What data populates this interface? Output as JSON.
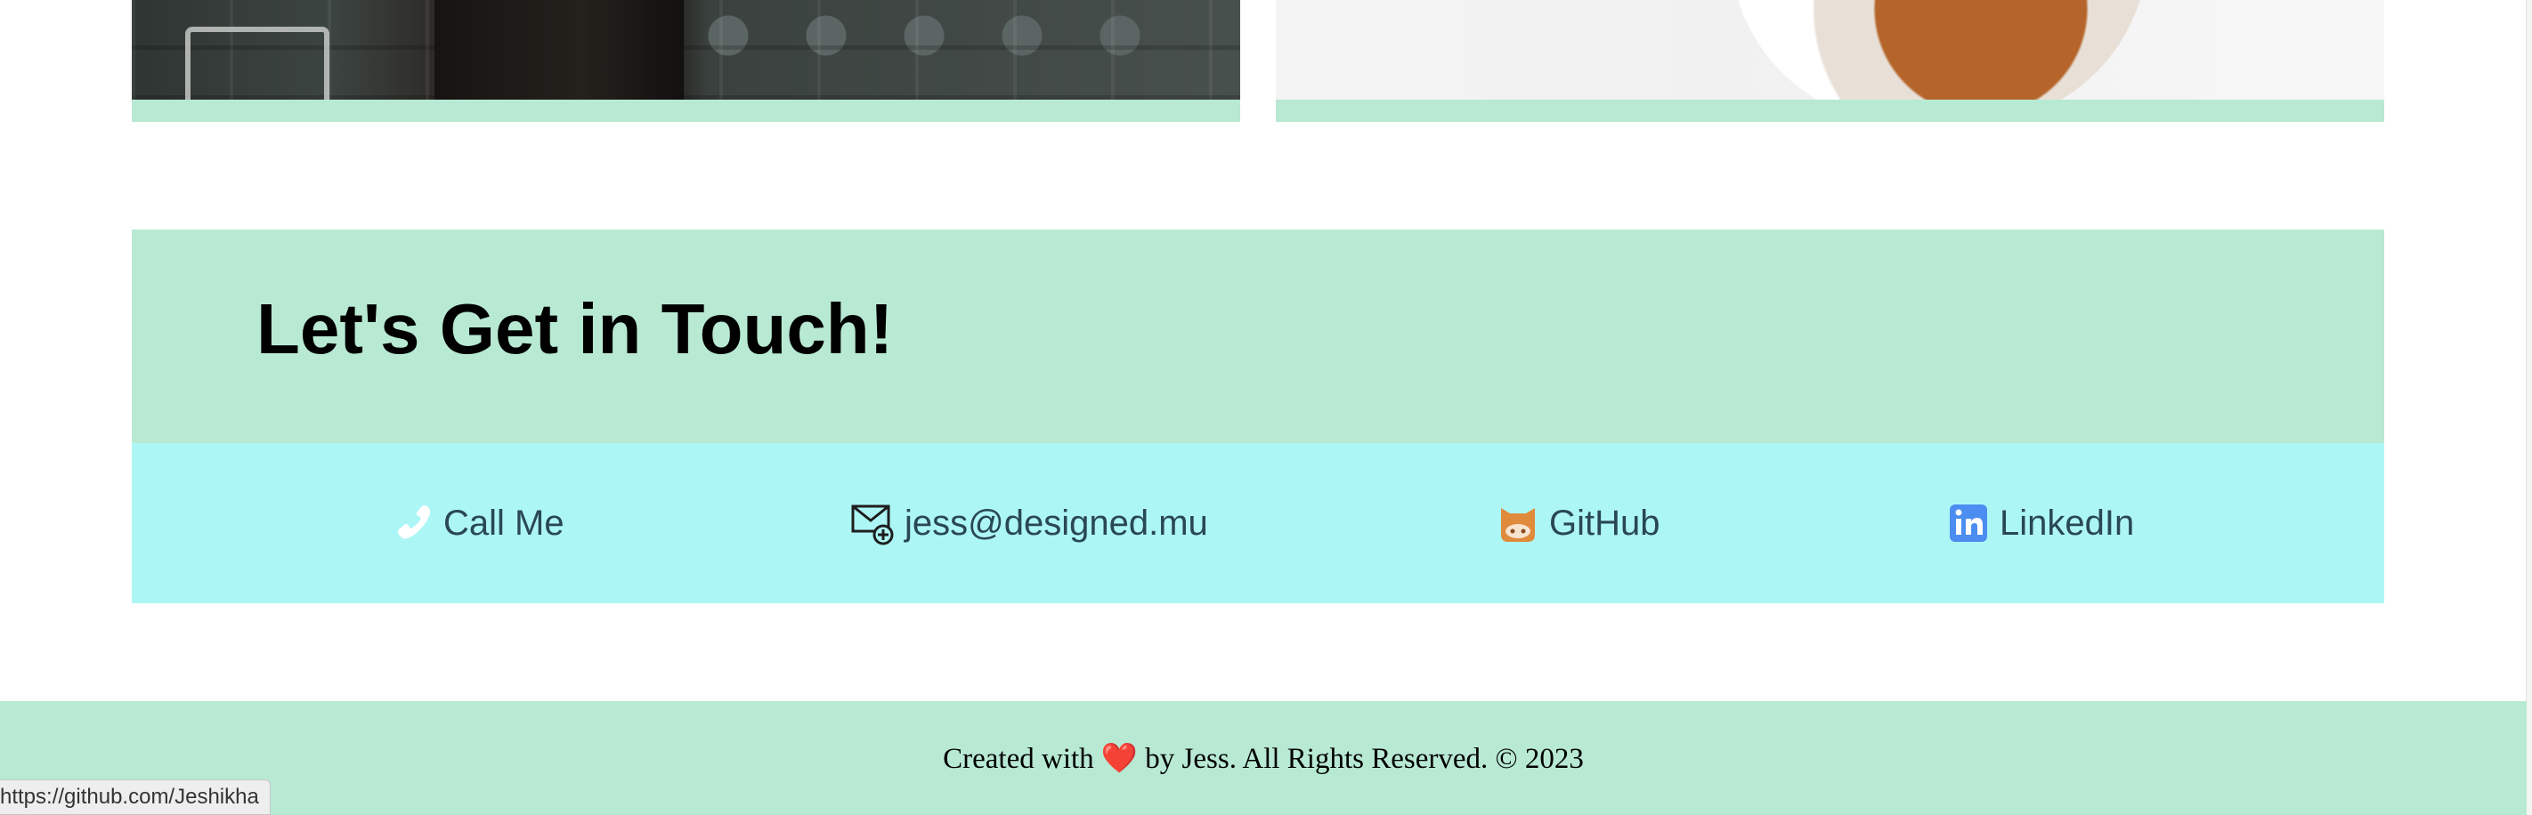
{
  "colors": {
    "mint": "#b8e9d3",
    "aqua": "#adf6f6",
    "link_text": "#2a4756",
    "heart": "#e0302a"
  },
  "projects": {
    "left_image": "woman-in-dark-outfit-photo",
    "right_image": "dog-close-up-photo"
  },
  "contact": {
    "title": "Let's Get in Touch!",
    "items": [
      {
        "label": "Call Me",
        "icon": "phone-icon"
      },
      {
        "label": "jess@designed.mu",
        "icon": "mail-icon"
      },
      {
        "label": "GitHub",
        "icon": "github-octocat-icon"
      },
      {
        "label": "LinkedIn",
        "icon": "linkedin-icon"
      }
    ]
  },
  "footer": {
    "text_before": "Created with",
    "heart": "❤️",
    "text_after": "by Jess. All Rights Reserved. © 2023"
  },
  "status_bar": {
    "url": "https://github.com/Jeshikha"
  }
}
